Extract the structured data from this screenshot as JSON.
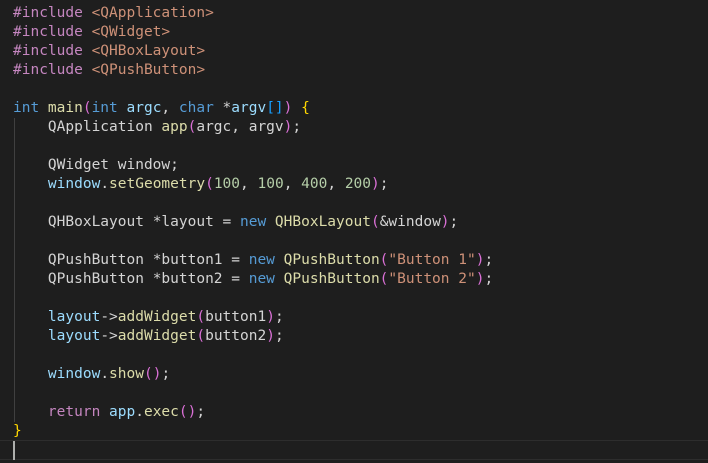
{
  "editor": {
    "theme_colors": {
      "background": "#1e1e1e",
      "keyword": "#c586c0",
      "include_path": "#ce9178",
      "type": "#569cd6",
      "function": "#dcdcaa",
      "variable": "#9cdcfe",
      "number": "#b5cea8",
      "string": "#ce9178",
      "bracket_level1": "#ffd700",
      "bracket_level2": "#da70d6",
      "bracket_level3": "#179fff"
    },
    "lines": [
      [
        {
          "t": "#include ",
          "c": "kw"
        },
        {
          "t": "<QApplication>",
          "c": "inc"
        }
      ],
      [
        {
          "t": "#include ",
          "c": "kw"
        },
        {
          "t": "<QWidget>",
          "c": "inc"
        }
      ],
      [
        {
          "t": "#include ",
          "c": "kw"
        },
        {
          "t": "<QHBoxLayout>",
          "c": "inc"
        }
      ],
      [
        {
          "t": "#include ",
          "c": "kw"
        },
        {
          "t": "<QPushButton>",
          "c": "inc"
        }
      ],
      [],
      [
        {
          "t": "int ",
          "c": "type"
        },
        {
          "t": "main",
          "c": "fn"
        },
        {
          "t": "(",
          "c": "br2"
        },
        {
          "t": "int ",
          "c": "type"
        },
        {
          "t": "argc",
          "c": "var"
        },
        {
          "t": ", ",
          "c": "plain"
        },
        {
          "t": "char ",
          "c": "type"
        },
        {
          "t": "*",
          "c": "op"
        },
        {
          "t": "argv",
          "c": "var"
        },
        {
          "t": "[]",
          "c": "br3"
        },
        {
          "t": ") ",
          "c": "br2"
        },
        {
          "t": "{",
          "c": "br1"
        }
      ],
      [
        {
          "t": "    QApplication ",
          "c": "cls"
        },
        {
          "t": "app",
          "c": "fn"
        },
        {
          "t": "(",
          "c": "br2"
        },
        {
          "t": "argc, argv",
          "c": "plain"
        },
        {
          "t": ")",
          "c": "br2"
        },
        {
          "t": ";",
          "c": "plain"
        }
      ],
      [],
      [
        {
          "t": "    QWidget ",
          "c": "cls"
        },
        {
          "t": "window;",
          "c": "plain"
        }
      ],
      [
        {
          "t": "    window",
          "c": "var"
        },
        {
          "t": ".",
          "c": "plain"
        },
        {
          "t": "setGeometry",
          "c": "fn"
        },
        {
          "t": "(",
          "c": "br2"
        },
        {
          "t": "100",
          "c": "num"
        },
        {
          "t": ", ",
          "c": "plain"
        },
        {
          "t": "100",
          "c": "num"
        },
        {
          "t": ", ",
          "c": "plain"
        },
        {
          "t": "400",
          "c": "num"
        },
        {
          "t": ", ",
          "c": "plain"
        },
        {
          "t": "200",
          "c": "num"
        },
        {
          "t": ")",
          "c": "br2"
        },
        {
          "t": ";",
          "c": "plain"
        }
      ],
      [],
      [
        {
          "t": "    QHBoxLayout ",
          "c": "cls"
        },
        {
          "t": "*layout = ",
          "c": "plain"
        },
        {
          "t": "new ",
          "c": "type"
        },
        {
          "t": "QHBoxLayout",
          "c": "fn"
        },
        {
          "t": "(",
          "c": "br2"
        },
        {
          "t": "&window",
          "c": "plain"
        },
        {
          "t": ")",
          "c": "br2"
        },
        {
          "t": ";",
          "c": "plain"
        }
      ],
      [],
      [
        {
          "t": "    QPushButton ",
          "c": "cls"
        },
        {
          "t": "*button1 = ",
          "c": "plain"
        },
        {
          "t": "new ",
          "c": "type"
        },
        {
          "t": "QPushButton",
          "c": "fn"
        },
        {
          "t": "(",
          "c": "br2"
        },
        {
          "t": "\"Button 1\"",
          "c": "str"
        },
        {
          "t": ")",
          "c": "br2"
        },
        {
          "t": ";",
          "c": "plain"
        }
      ],
      [
        {
          "t": "    QPushButton ",
          "c": "cls"
        },
        {
          "t": "*button2 = ",
          "c": "plain"
        },
        {
          "t": "new ",
          "c": "type"
        },
        {
          "t": "QPushButton",
          "c": "fn"
        },
        {
          "t": "(",
          "c": "br2"
        },
        {
          "t": "\"Button 2\"",
          "c": "str"
        },
        {
          "t": ")",
          "c": "br2"
        },
        {
          "t": ";",
          "c": "plain"
        }
      ],
      [],
      [
        {
          "t": "    layout",
          "c": "var"
        },
        {
          "t": "->",
          "c": "plain"
        },
        {
          "t": "addWidget",
          "c": "fn"
        },
        {
          "t": "(",
          "c": "br2"
        },
        {
          "t": "button1",
          "c": "plain"
        },
        {
          "t": ")",
          "c": "br2"
        },
        {
          "t": ";",
          "c": "plain"
        }
      ],
      [
        {
          "t": "    layout",
          "c": "var"
        },
        {
          "t": "->",
          "c": "plain"
        },
        {
          "t": "addWidget",
          "c": "fn"
        },
        {
          "t": "(",
          "c": "br2"
        },
        {
          "t": "button2",
          "c": "plain"
        },
        {
          "t": ")",
          "c": "br2"
        },
        {
          "t": ";",
          "c": "plain"
        }
      ],
      [],
      [
        {
          "t": "    window",
          "c": "var"
        },
        {
          "t": ".",
          "c": "plain"
        },
        {
          "t": "show",
          "c": "fn"
        },
        {
          "t": "()",
          "c": "br2"
        },
        {
          "t": ";",
          "c": "plain"
        }
      ],
      [],
      [
        {
          "t": "    return ",
          "c": "ctl"
        },
        {
          "t": "app",
          "c": "var"
        },
        {
          "t": ".",
          "c": "plain"
        },
        {
          "t": "exec",
          "c": "fn"
        },
        {
          "t": "()",
          "c": "br2"
        },
        {
          "t": ";",
          "c": "plain"
        }
      ],
      [
        {
          "t": "}",
          "c": "br1"
        }
      ],
      []
    ]
  }
}
